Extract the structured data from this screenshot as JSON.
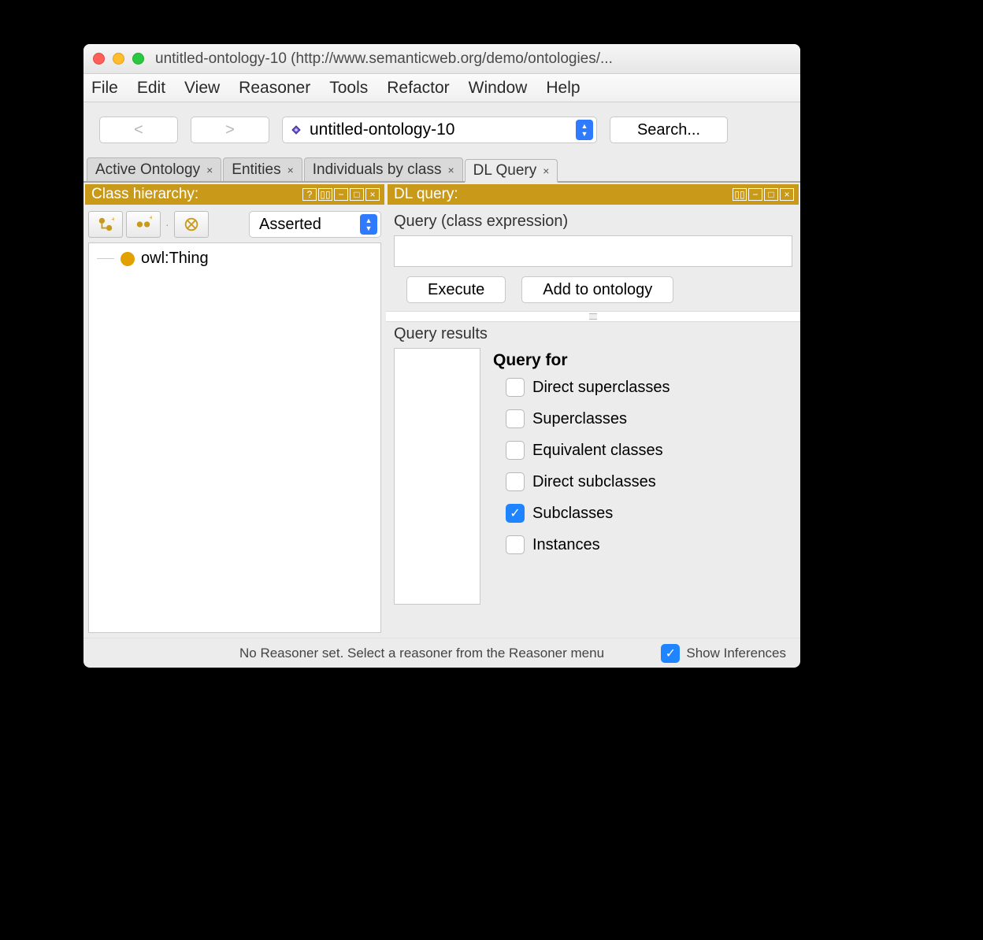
{
  "window": {
    "title": "untitled-ontology-10 (http://www.semanticweb.org/demo/ontologies/..."
  },
  "menubar": [
    "File",
    "Edit",
    "View",
    "Reasoner",
    "Tools",
    "Refactor",
    "Window",
    "Help"
  ],
  "toolbar": {
    "back": "<",
    "forward": ">",
    "ontology_selected": "untitled-ontology-10",
    "search": "Search..."
  },
  "tabs": [
    {
      "label": "Active Ontology",
      "closable": true,
      "active": false
    },
    {
      "label": "Entities",
      "closable": true,
      "active": false
    },
    {
      "label": "Individuals by class",
      "closable": true,
      "active": false
    },
    {
      "label": "DL Query",
      "closable": true,
      "active": true
    }
  ],
  "left_pane": {
    "title": "Class hierarchy:",
    "mode_selected": "Asserted",
    "root_node": "owl:Thing"
  },
  "right_pane": {
    "title": "DL query:",
    "query_label": "Query (class expression)",
    "query_value": "",
    "execute": "Execute",
    "add_to_ontology": "Add to ontology",
    "results_label": "Query results",
    "query_for_title": "Query for",
    "options": [
      {
        "label": "Direct superclasses",
        "checked": false
      },
      {
        "label": "Superclasses",
        "checked": false
      },
      {
        "label": "Equivalent classes",
        "checked": false
      },
      {
        "label": "Direct subclasses",
        "checked": false
      },
      {
        "label": "Subclasses",
        "checked": true
      },
      {
        "label": "Instances",
        "checked": false
      }
    ]
  },
  "footer": {
    "status": "No Reasoner set. Select a reasoner from the Reasoner menu",
    "show_inferences": {
      "label": "Show Inferences",
      "checked": true
    }
  }
}
